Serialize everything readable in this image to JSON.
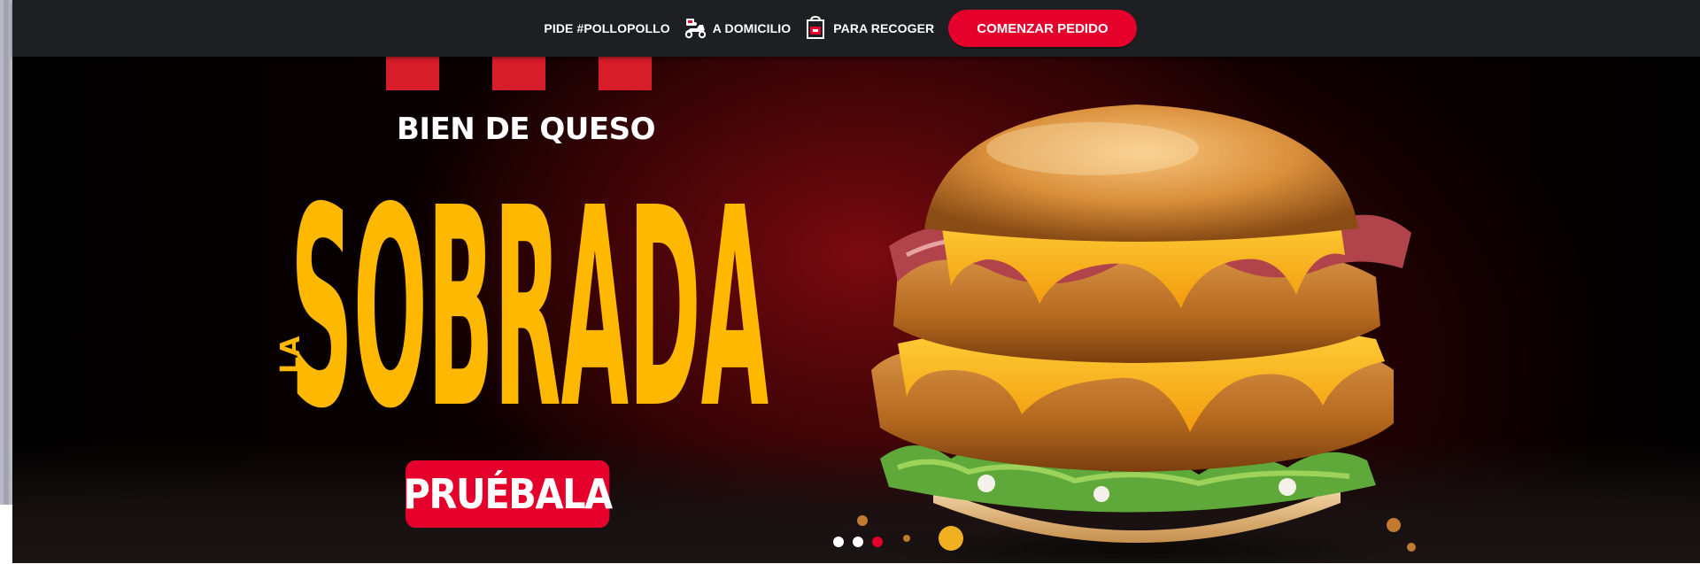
{
  "nav": {
    "hashtag_label": "PIDE #POLLOPOLLO",
    "delivery_label": "A DOMICILIO",
    "delivery_icon": "delivery-scooter-icon",
    "pickup_label": "PARA RECOGER",
    "pickup_icon": "pickup-bag-icon",
    "cta_label": "COMENZAR PEDIDO"
  },
  "hero": {
    "tagline": "BIEN DE QUESO",
    "title_prefix": "LA",
    "title": "SOBRADA",
    "cta_label": "PRUÉBALA",
    "image": "chicken-burger-image"
  },
  "carousel": {
    "slide_count": 3,
    "active_index": 2
  },
  "colors": {
    "brand_red": "#e4002b",
    "title_yellow": "#ffb800",
    "bar_background": "#1e1f22"
  }
}
